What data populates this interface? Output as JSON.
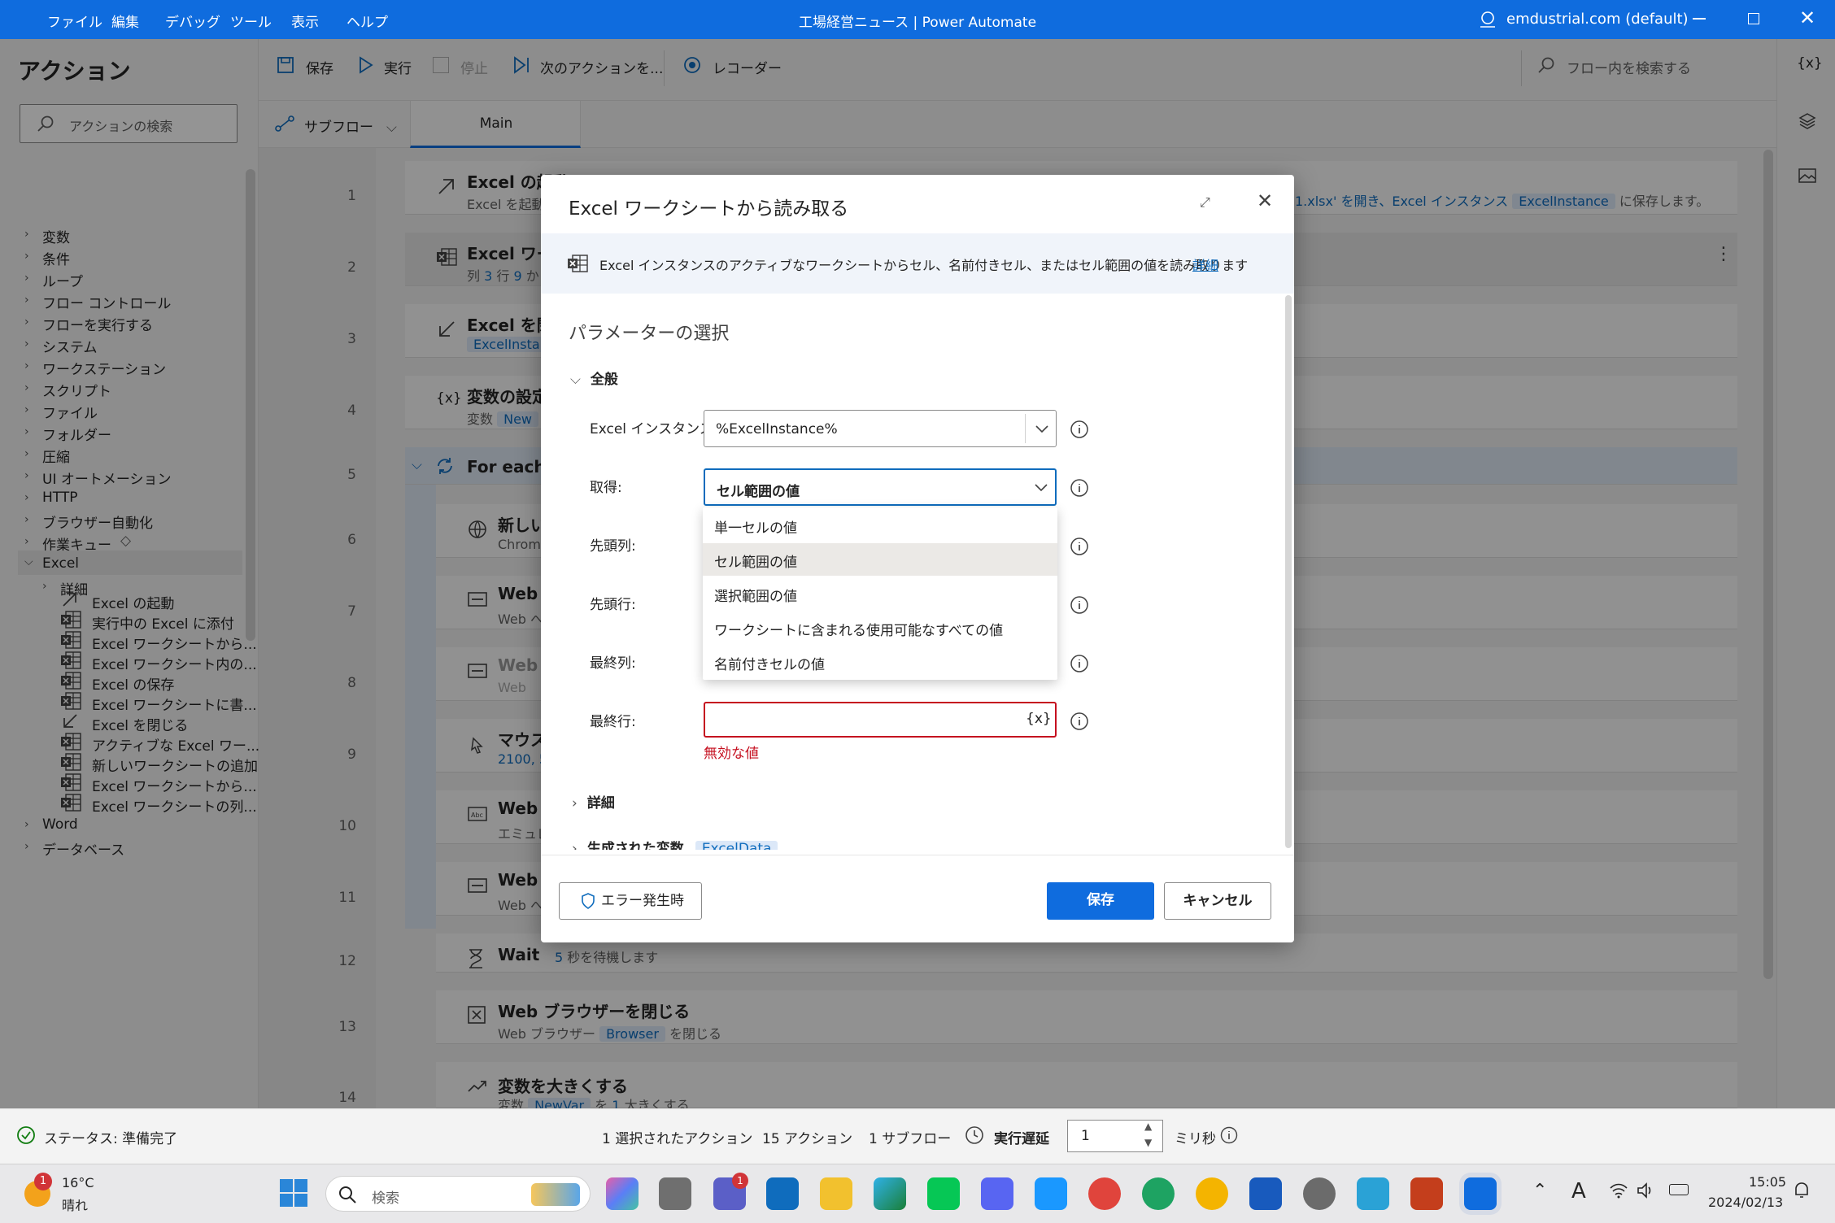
{
  "menu": [
    "ファイル",
    "編集",
    "デバッグ",
    "ツール",
    "表示",
    "ヘルプ"
  ],
  "window_title": "工場経営ニュース | Power Automate",
  "account": "emdustrial.com (default)",
  "left": {
    "title": "アクション",
    "search_placeholder": "アクションの検索",
    "categories": [
      "変数",
      "条件",
      "ループ",
      "フロー コントロール",
      "フローを実行する",
      "システム",
      "ワークステーション",
      "スクリプト",
      "ファイル",
      "フォルダー",
      "圧縮",
      "UI オートメーション",
      "HTTP",
      "ブラウザー自動化",
      "作業キュー",
      "Excel"
    ],
    "excel_detail": "詳細",
    "excel_items": [
      "Excel の起動",
      "実行中の Excel に添付",
      "Excel ワークシートから...",
      "Excel ワークシート内の...",
      "Excel の保存",
      "Excel ワークシートに書...",
      "Excel を閉じる",
      "アクティブな Excel ワー...",
      "新しいワークシートの追加",
      "Excel ワークシートから...",
      "Excel ワークシートの列..."
    ],
    "after": [
      "Word",
      "データベース"
    ]
  },
  "toolbar": {
    "save": "保存",
    "run": "実行",
    "stop": "停止",
    "next": "次のアクションを...",
    "recorder": "レコーダー",
    "search": "フロー内を検索する",
    "subflow": "サブフロー",
    "tab_main": "Main"
  },
  "steps": [
    {
      "n": "1",
      "title": "Excel の起動",
      "sub": "Excel を起動"
    },
    {
      "n": "2",
      "title": "Excel ワー",
      "sub1": "列",
      "v1": "3",
      "sub2": "行",
      "v2": "9",
      "sub3": "か"
    },
    {
      "n": "3",
      "title": "Excel を閉",
      "chip": "ExcelInsta"
    },
    {
      "n": "4",
      "title": "変数の設定",
      "sub": "変数",
      "chip": "New"
    },
    {
      "n": "5",
      "title": "For each"
    },
    {
      "n": "6",
      "title": "新しい",
      "sub": "Chrom"
    },
    {
      "n": "7",
      "title": "Web",
      "sub": "Web へ"
    },
    {
      "n": "8",
      "title": "Web",
      "sub": "Web"
    },
    {
      "n": "9",
      "title": "マウス",
      "sub": "2100, 5"
    },
    {
      "n": "10",
      "title": "Web",
      "sub": "エミュレ"
    },
    {
      "n": "11",
      "title": "Web",
      "sub": "Web へ"
    },
    {
      "n": "12",
      "title": "Wait",
      "v": "5",
      "rest": "秒を待機します"
    },
    {
      "n": "13",
      "title": "Web ブラウザーを閉じる",
      "sub": "Web ブラウザー",
      "chip": "Browser",
      "rest": "を閉じる"
    },
    {
      "n": "14",
      "title": "変数を大きくする",
      "sub": "変数",
      "chip": "NewVar",
      "rest": "を",
      "v": "1",
      "rest2": "大きくする"
    }
  ],
  "step1_tail": {
    "file": "1.xlsx' を開き、Excel インスタンス",
    "chip": "ExcelInstance",
    "rest": "に保存します。"
  },
  "dialog": {
    "title": "Excel ワークシートから読み取る",
    "desc": "Excel インスタンスのアクティブなワークシートからセル、名前付きセル、またはセル範囲の値を読み取ります",
    "desc_link": "詳細",
    "section": "パラメーターの選択",
    "group": "全般",
    "labels": {
      "instance": "Excel インスタンス:",
      "get": "取得:",
      "first_col": "先頭列:",
      "first_row": "先頭行:",
      "last_col": "最終列:",
      "last_row": "最終行:"
    },
    "instance_value": "%ExcelInstance%",
    "get_value": "セル範囲の値",
    "options": [
      "単一セルの値",
      "セル範囲の値",
      "選択範囲の値",
      "ワークシートに含まれる使用可能なすべての値",
      "名前付きセルの値"
    ],
    "var_button": "{x}",
    "error": "無効な値",
    "details": "詳細",
    "generated": "生成された変数",
    "generated_chip": "ExcelData",
    "on_error": "エラー発生時",
    "save": "保存",
    "cancel": "キャンセル"
  },
  "status": {
    "state": "ステータス: 準備完了",
    "selected": "1 選択されたアクション",
    "actions": "15 アクション",
    "subflows": "1 サブフロー",
    "delay_label": "実行遅延",
    "delay_value": "1",
    "unit": "ミリ秒"
  },
  "taskbar": {
    "temp": "16°C",
    "weather": "晴れ",
    "search": "検索",
    "time": "15:05",
    "date": "2024/02/13",
    "badge": "1"
  },
  "colors": {
    "accent": "#0f6cde",
    "error": "#c50f1f",
    "link": "#0f6cbd"
  }
}
